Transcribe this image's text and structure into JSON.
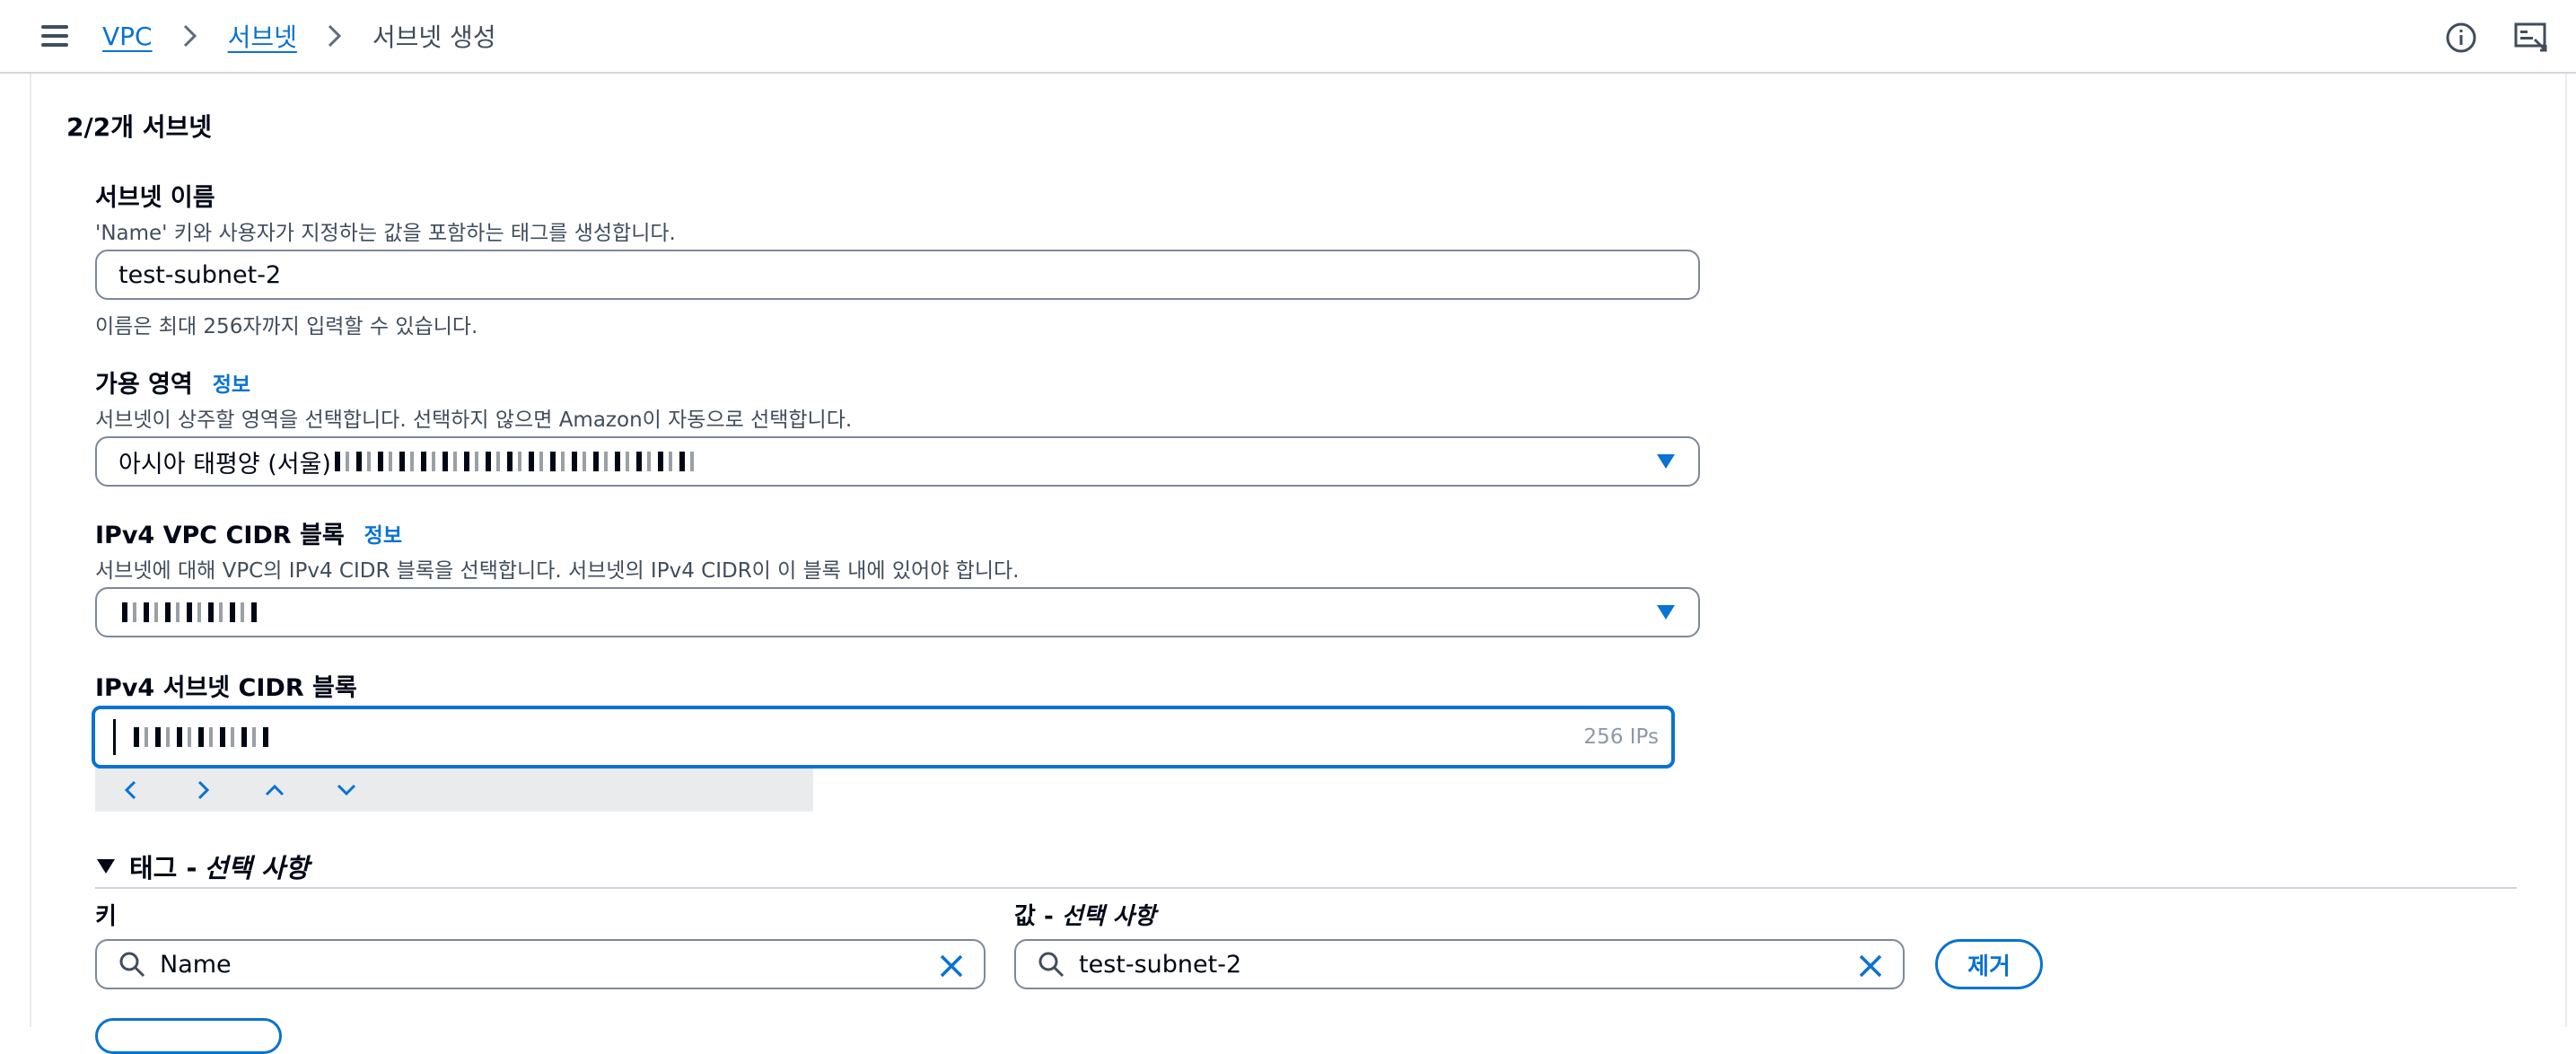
{
  "breadcrumb": {
    "items": [
      "VPC",
      "서브넷"
    ],
    "current": "서브넷 생성"
  },
  "section": {
    "title": "2/2개 서브넷"
  },
  "subnet_name": {
    "label": "서브넷 이름",
    "description": "'Name' 키와 사용자가 지정하는 값을 포함하는 태그를 생성합니다.",
    "value": "test-subnet-2",
    "hint": "이름은 최대 256자까지 입력할 수 있습니다."
  },
  "availability_zone": {
    "label": "가용 영역",
    "info": "정보",
    "description": "서브넷이 상주할 영역을 선택합니다. 선택하지 않으면 Amazon이 자동으로 선택합니다.",
    "value": "아시아 태평양 (서울)"
  },
  "vpc_cidr": {
    "label": "IPv4 VPC CIDR 블록",
    "info": "정보",
    "description": "서브넷에 대해 VPC의 IPv4 CIDR 블록을 선택합니다. 서브넷의 IPv4 CIDR이 이 블록 내에 있어야 합니다."
  },
  "subnet_cidr": {
    "label": "IPv4 서브넷 CIDR 블록",
    "ip_count": "256 IPs"
  },
  "tags": {
    "header": "태그 -",
    "header_optional": "선택 사항",
    "key_label": "키",
    "value_label": "값 -",
    "value_label_optional": "선택 사항",
    "rows": [
      {
        "key": "Name",
        "value": "test-subnet-2"
      }
    ],
    "remove_label": "제거"
  },
  "colors": {
    "link": "#0972d3",
    "text": "#000716",
    "secondary_text": "#414d5c",
    "border": "#7d8998"
  },
  "icons": [
    "menu-icon",
    "chevron-right-icon",
    "info-icon",
    "split-panel-icon",
    "caret-down-icon",
    "search-icon",
    "close-icon",
    "chevron-left-icon",
    "chevron-up-icon",
    "chevron-down-icon",
    "triangle-down-icon"
  ]
}
